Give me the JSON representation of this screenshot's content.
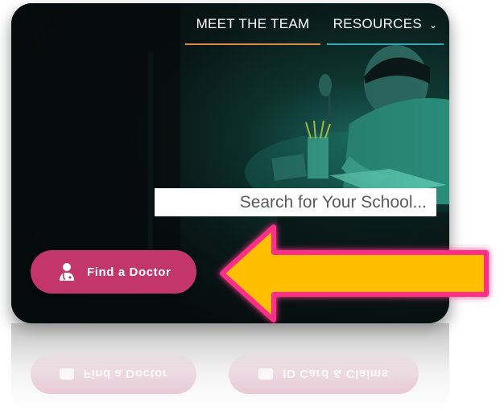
{
  "nav": {
    "items": [
      {
        "label": "MEET THE TEAM",
        "underline_color": "#e0894a"
      },
      {
        "label": "RESOURCES",
        "underline_color": "#3aa7b8",
        "icon": "chevron-down-icon"
      }
    ]
  },
  "search": {
    "placeholder": "Search for Your School..."
  },
  "cta": {
    "label": "Find a Doctor",
    "icon": "doctor-icon",
    "color": "#c2366c"
  },
  "reflection": {
    "left_label": "Find a Doctor",
    "right_label": "ID Card & Claims"
  },
  "annotation": {
    "arrow_color": "#ffbe00",
    "glow_color": "#ff2d8a"
  }
}
